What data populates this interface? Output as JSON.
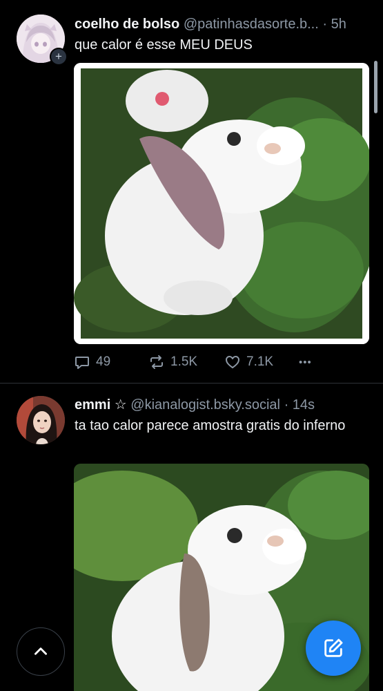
{
  "colors": {
    "background": "#000000",
    "text": "#f1f3f5",
    "muted": "#8d98a5",
    "divider": "#2e3339",
    "accent": "#1f84f5"
  },
  "posts": [
    {
      "display_name": "coelho de bolso",
      "handle": "@patinhasdasorte.b...",
      "separator": "·",
      "time": "5h",
      "text": "que calor é esse MEU DEUS",
      "avatar_icon": "anime-girl-avatar",
      "follow_badge": "+",
      "media_description_icon": "white-rabbit-image",
      "actions": {
        "replies": "49",
        "reposts": "1.5K",
        "likes": "7.1K",
        "more": "•••"
      }
    },
    {
      "display_name": "emmi ☆",
      "handle": "@kianalogist.bsky.social",
      "separator": "·",
      "time": "14s",
      "text": "ta tao calor parece amostra gratis do inferno",
      "avatar_icon": "girl-photo-avatar",
      "media_description_icon": "white-rabbit-image"
    }
  ],
  "floating": {
    "scroll_top_icon": "chevron-up-icon",
    "compose_icon": "compose-icon"
  }
}
